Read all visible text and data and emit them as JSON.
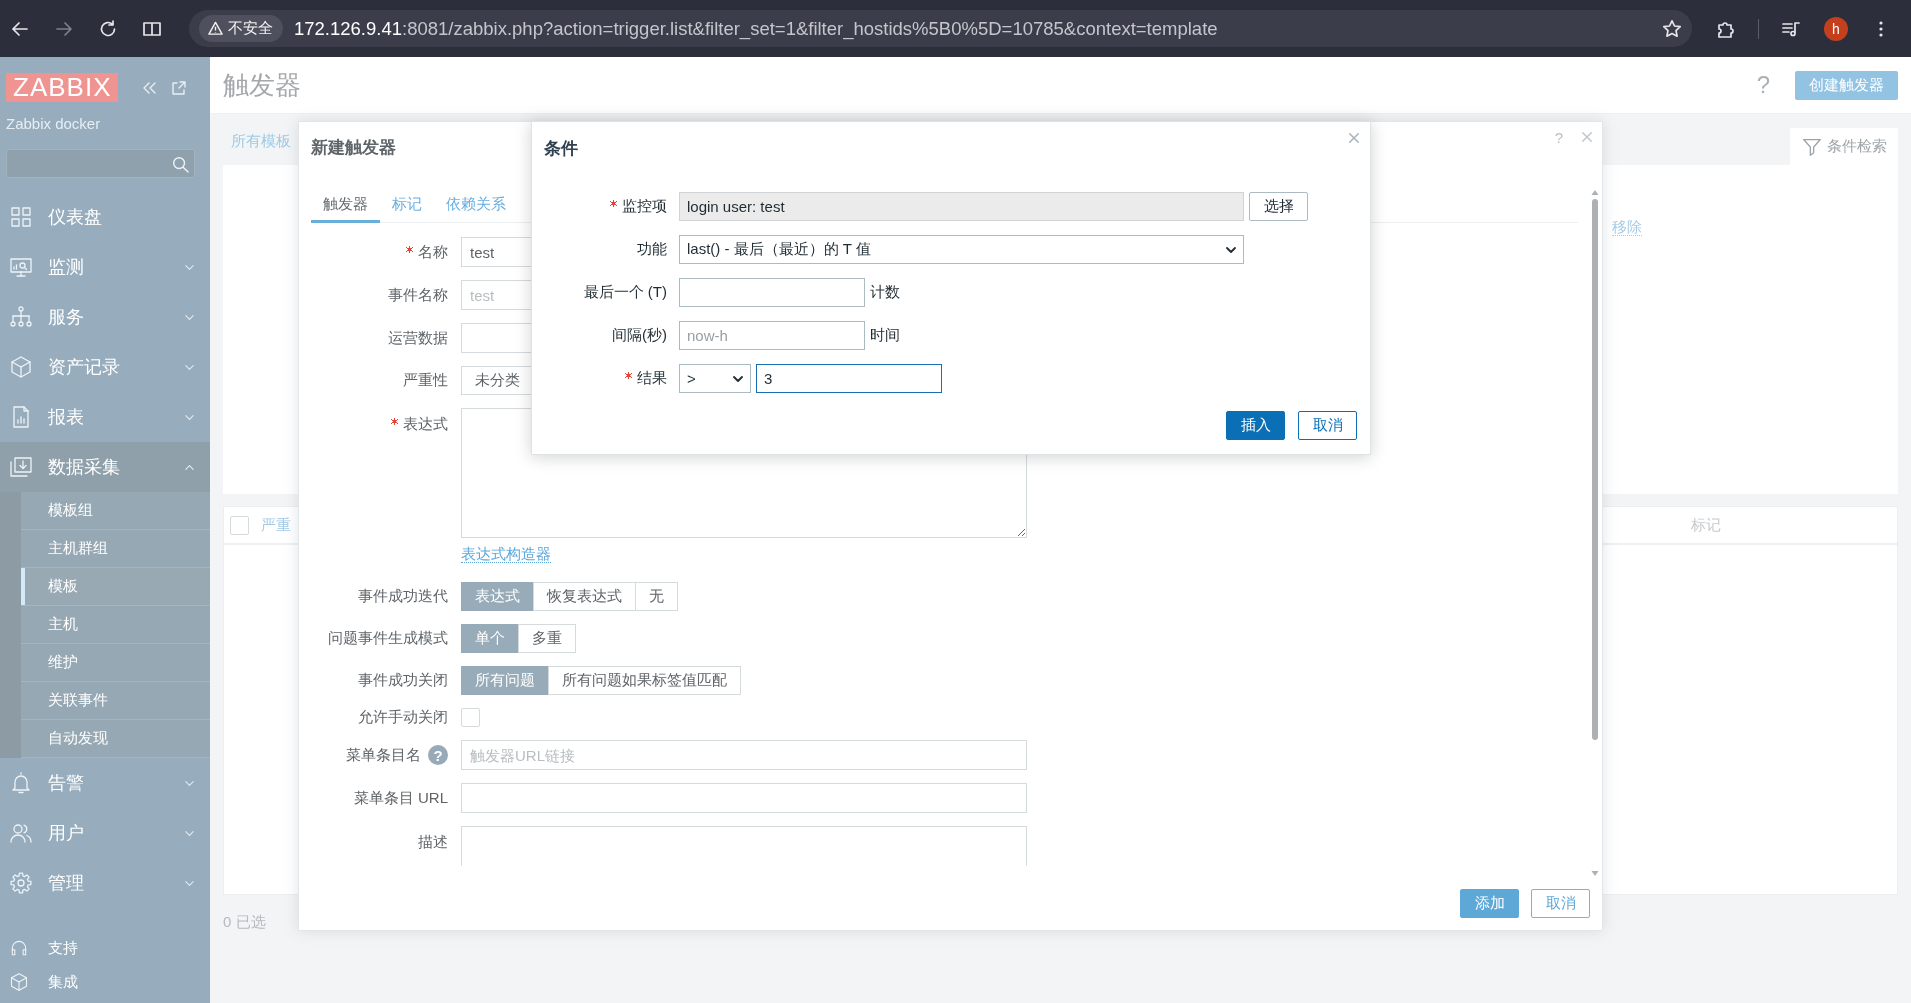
{
  "browser": {
    "back_enabled": true,
    "forward_enabled": false,
    "security_label": "不安全",
    "url_host": "172.126.9.41",
    "url_rest": ":8081/zabbix.php?action=trigger.list&filter_set=1&filter_hostids%5B0%5D=10785&context=template",
    "profile_initial": "h"
  },
  "sidebar": {
    "logo": "ZABBIX",
    "server_name": "Zabbix docker",
    "menu": [
      {
        "label": "仪表盘",
        "kind": "link"
      },
      {
        "label": "监测",
        "kind": "group",
        "expanded": false
      },
      {
        "label": "服务",
        "kind": "group",
        "expanded": false
      },
      {
        "label": "资产记录",
        "kind": "group",
        "expanded": false
      },
      {
        "label": "报表",
        "kind": "group",
        "expanded": false
      },
      {
        "label": "数据采集",
        "kind": "group",
        "expanded": true,
        "children": [
          {
            "label": "模板组",
            "selected": false
          },
          {
            "label": "主机群组",
            "selected": false
          },
          {
            "label": "模板",
            "selected": true
          },
          {
            "label": "主机",
            "selected": false
          },
          {
            "label": "维护",
            "selected": false
          },
          {
            "label": "关联事件",
            "selected": false
          },
          {
            "label": "自动发现",
            "selected": false
          }
        ]
      },
      {
        "label": "告警",
        "kind": "group",
        "expanded": false
      },
      {
        "label": "用户",
        "kind": "group",
        "expanded": false
      },
      {
        "label": "管理",
        "kind": "group",
        "expanded": false
      }
    ],
    "footer_menu": [
      {
        "label": "支持"
      },
      {
        "label": "集成"
      }
    ]
  },
  "page": {
    "title": "触发器",
    "help": "?",
    "create_button": "创建触发器",
    "breadcrumb": "所有模板",
    "filter_tab": "条件检索",
    "filter_remove_link": "移除",
    "table": {
      "select_all_checked": false,
      "columns": [
        {
          "label": "严重",
          "kind": "sortable"
        },
        {
          "label": "标记",
          "kind": "plain"
        }
      ]
    },
    "selected_count": "0 已选"
  },
  "trigger_dialog": {
    "title": "新建触发器",
    "help": "?",
    "tabs": [
      {
        "label": "触发器",
        "selected": true
      },
      {
        "label": "标记",
        "selected": false
      },
      {
        "label": "依赖关系",
        "selected": false
      }
    ],
    "fields": [
      {
        "kind": "text",
        "label": "名称",
        "required": true,
        "value": "test"
      },
      {
        "kind": "text",
        "label": "事件名称",
        "required": false,
        "placeholder": "test"
      },
      {
        "kind": "text",
        "label": "运营数据",
        "required": false
      },
      {
        "kind": "segmented",
        "label": "严重性",
        "required": false,
        "options": [
          {
            "label": "未分类",
            "selected": false
          }
        ]
      },
      {
        "kind": "textarea",
        "label": "表达式",
        "required": true,
        "link": "表达式构造器"
      },
      {
        "kind": "segmented",
        "label": "事件成功迭代",
        "required": false,
        "options": [
          {
            "label": "表达式",
            "selected": true
          },
          {
            "label": "恢复表达式",
            "selected": false
          },
          {
            "label": "无",
            "selected": false
          }
        ]
      },
      {
        "kind": "segmented",
        "label": "问题事件生成模式",
        "required": false,
        "options": [
          {
            "label": "单个",
            "selected": true
          },
          {
            "label": "多重",
            "selected": false
          }
        ]
      },
      {
        "kind": "segmented",
        "label": "事件成功关闭",
        "required": false,
        "options": [
          {
            "label": "所有问题",
            "selected": true
          },
          {
            "label": "所有问题如果标签值匹配",
            "selected": false
          }
        ]
      },
      {
        "kind": "checkbox",
        "label": "允许手动关闭",
        "required": false,
        "checked": false
      },
      {
        "kind": "text",
        "label": "菜单条目名",
        "required": false,
        "hint": "?",
        "placeholder": "触发器URL链接"
      },
      {
        "kind": "text",
        "label": "菜单条目 URL",
        "required": false
      },
      {
        "kind": "textarea",
        "label": "描述",
        "required": false
      }
    ],
    "buttons": [
      {
        "label": "添加",
        "kind": "primary"
      },
      {
        "label": "取消",
        "kind": "secondary"
      }
    ]
  },
  "condition_dialog": {
    "title": "条件",
    "fields": [
      {
        "kind": "item",
        "label": "监控项",
        "required": true,
        "value": "login user: test",
        "button": "选择",
        "focused": false
      },
      {
        "kind": "select",
        "label": "功能",
        "required": false,
        "value": "last() - 最后（最近）的 T 值",
        "focused": false
      },
      {
        "kind": "text",
        "label": "最后一个 (T)",
        "required": false,
        "suffix": "计数",
        "focused": false
      },
      {
        "kind": "text",
        "label": "间隔(秒)",
        "required": false,
        "placeholder": "now-h",
        "suffix": "时间",
        "focused": false
      },
      {
        "kind": "compare",
        "label": "结果",
        "required": true,
        "operator": ">",
        "value": "3",
        "focused": true
      }
    ],
    "buttons": [
      {
        "label": "插入",
        "kind": "primary"
      },
      {
        "label": "取消",
        "kind": "secondary"
      }
    ]
  }
}
